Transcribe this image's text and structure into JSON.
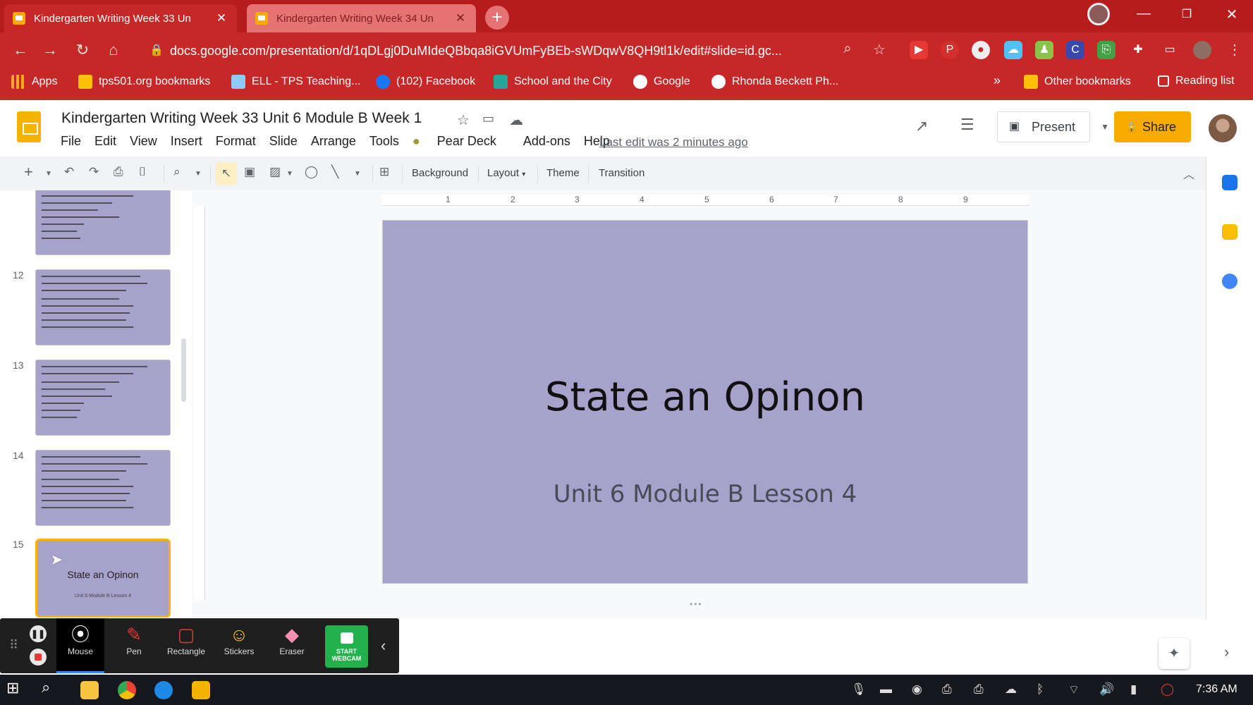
{
  "browser": {
    "tabs": [
      {
        "title": "Kindergarten Writing Week 33 Un",
        "active": true
      },
      {
        "title": "Kindergarten Writing Week 34 Un",
        "active": false
      }
    ],
    "new_tab": "+",
    "url": "docs.google.com/presentation/d/1qDLgj0DuMIdeQBbqa8iGVUmFyBEb-sWDqwV8QH9tl1k/edit#slide=id.gc...",
    "bookmarks": [
      "Apps",
      "tps501.org bookmarks",
      "ELL - TPS Teaching...",
      "(102) Facebook",
      "School and the City",
      "Google",
      "Rhonda Beckett Ph..."
    ],
    "more_bookmarks": "»",
    "other_bookmarks": "Other bookmarks",
    "reading_list": "Reading list"
  },
  "app": {
    "title": "Kindergarten Writing Week 33 Unit 6 Module B Week 1",
    "menu": [
      "File",
      "Edit",
      "View",
      "Insert",
      "Format",
      "Slide",
      "Arrange",
      "Tools",
      "Pear Deck",
      "Add-ons",
      "Help"
    ],
    "last_edit": "Last edit was 2 minutes ago",
    "present_label": "Present",
    "share_label": "Share"
  },
  "toolbar": {
    "background": "Background",
    "layout": "Layout",
    "theme": "Theme",
    "transition": "Transition"
  },
  "ruler": {
    "marks": [
      "1",
      "2",
      "3",
      "4",
      "5",
      "6",
      "7",
      "8",
      "9"
    ]
  },
  "filmstrip": {
    "slide_numbers": [
      "12",
      "13",
      "14",
      "15"
    ],
    "current_thumb": {
      "title": "State an Opinon",
      "subtitle": "Unit 6 Module B Lesson 4"
    }
  },
  "slide": {
    "title": "State an Opinon",
    "subtitle": "Unit 6 Module B Lesson 4",
    "background_color": "#a7a2cc"
  },
  "annotation_toolbar": {
    "tools": [
      "Mouse",
      "Pen",
      "Rectangle",
      "Stickers",
      "Eraser"
    ],
    "webcam": "START WEBCAM"
  },
  "taskbar": {
    "time": "7:36 AM"
  },
  "colors": {
    "chrome_red": "#c62828",
    "slides_yellow": "#f4b400",
    "share_yellow": "#f9ab00",
    "webcam_green": "#23b14d"
  }
}
